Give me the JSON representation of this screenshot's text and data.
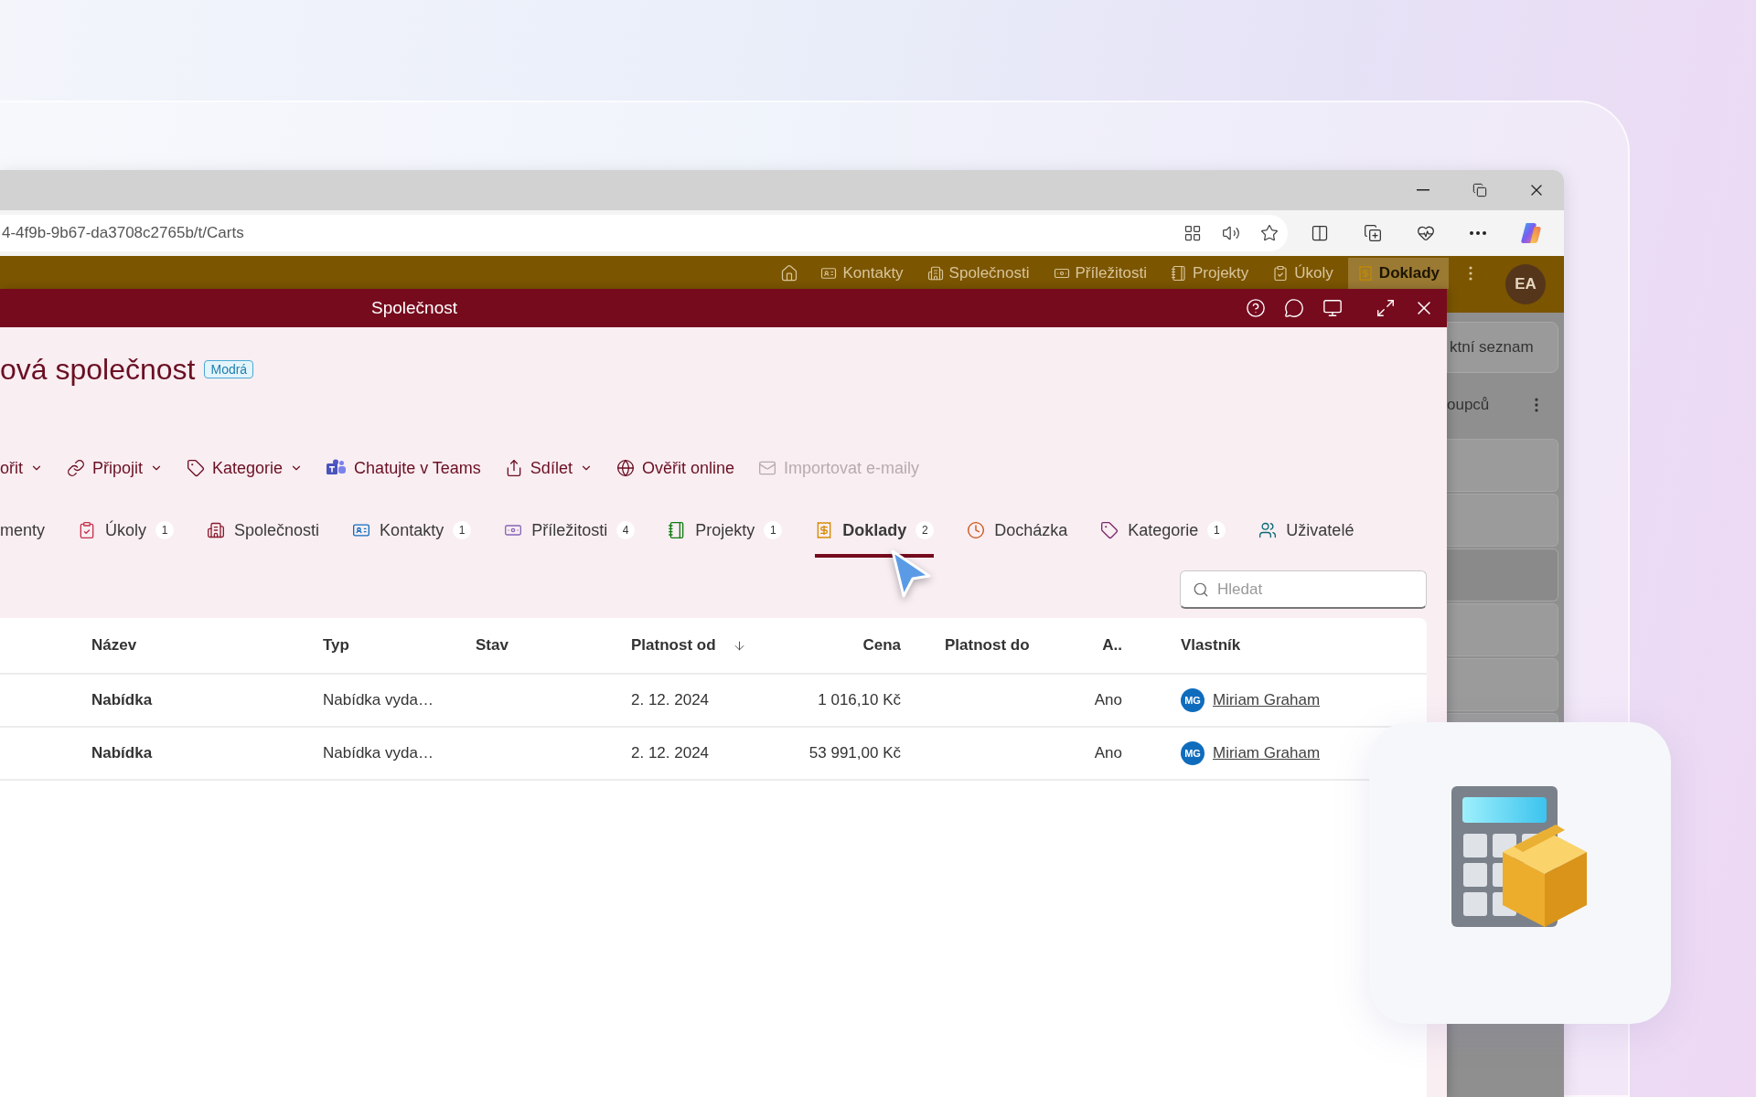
{
  "browser": {
    "url": "4-4f9b-9b67-da3708c2765b/t/Carts"
  },
  "app_nav": {
    "items": [
      {
        "label": "Kontakty",
        "selected": false
      },
      {
        "label": "Společnosti",
        "selected": false
      },
      {
        "label": "Příležitosti",
        "selected": false
      },
      {
        "label": "Projekty",
        "selected": false
      },
      {
        "label": "Úkoly",
        "selected": false
      },
      {
        "label": "Doklady",
        "selected": true
      }
    ],
    "avatar": "EA"
  },
  "background_panel": {
    "button": "ktní seznam",
    "label": "oupců"
  },
  "dialog": {
    "title": "Společnost",
    "record_title": "ová společnost",
    "tag": "Modrá",
    "toolbar": [
      {
        "label": "ořit",
        "dropdown": true,
        "disabled": false
      },
      {
        "label": "Připojit",
        "dropdown": true,
        "disabled": false
      },
      {
        "label": "Kategorie",
        "dropdown": true,
        "disabled": false
      },
      {
        "label": "Chatujte v Teams",
        "dropdown": false,
        "disabled": false
      },
      {
        "label": "Sdílet",
        "dropdown": true,
        "disabled": false
      },
      {
        "label": "Ověřit online",
        "dropdown": false,
        "disabled": false
      },
      {
        "label": "Importovat e-maily",
        "dropdown": false,
        "disabled": true
      }
    ],
    "tabs": [
      {
        "label": "menty",
        "selected": false
      },
      {
        "label": "Úkoly",
        "count": "1",
        "selected": false
      },
      {
        "label": "Společnosti",
        "selected": false
      },
      {
        "label": "Kontakty",
        "count": "1",
        "selected": false
      },
      {
        "label": "Příležitosti",
        "count": "4",
        "selected": false
      },
      {
        "label": "Projekty",
        "count": "1",
        "selected": false
      },
      {
        "label": "Doklady",
        "count": "2",
        "selected": true
      },
      {
        "label": "Docházka",
        "selected": false
      },
      {
        "label": "Kategorie",
        "count": "1",
        "selected": false
      },
      {
        "label": "Uživatelé",
        "selected": false
      }
    ],
    "search": {
      "placeholder": "Hledat"
    },
    "table": {
      "columns": [
        {
          "label": "Název",
          "sorted": false
        },
        {
          "label": "Typ",
          "sorted": false
        },
        {
          "label": "Stav",
          "sorted": false
        },
        {
          "label": "Platnost od",
          "sorted": true
        },
        {
          "label": "Cena",
          "sorted": false
        },
        {
          "label": "Platnost do",
          "sorted": false
        },
        {
          "label": "A..",
          "sorted": false
        },
        {
          "label": "Vlastník",
          "sorted": false
        }
      ],
      "rows": [
        {
          "name": "Nabídka",
          "type": "Nabídka vyda…",
          "valid_from": "2. 12. 2024",
          "price": "1 016,10 Kč",
          "a": "Ano",
          "owner": {
            "initials": "MG",
            "name": "Miriam Graham"
          }
        },
        {
          "name": "Nabídka",
          "type": "Nabídka vyda…",
          "valid_from": "2. 12. 2024",
          "price": "53 991,00 Kč",
          "a": "Ano",
          "owner": {
            "initials": "MG",
            "name": "Miriam Graham"
          }
        }
      ]
    }
  }
}
